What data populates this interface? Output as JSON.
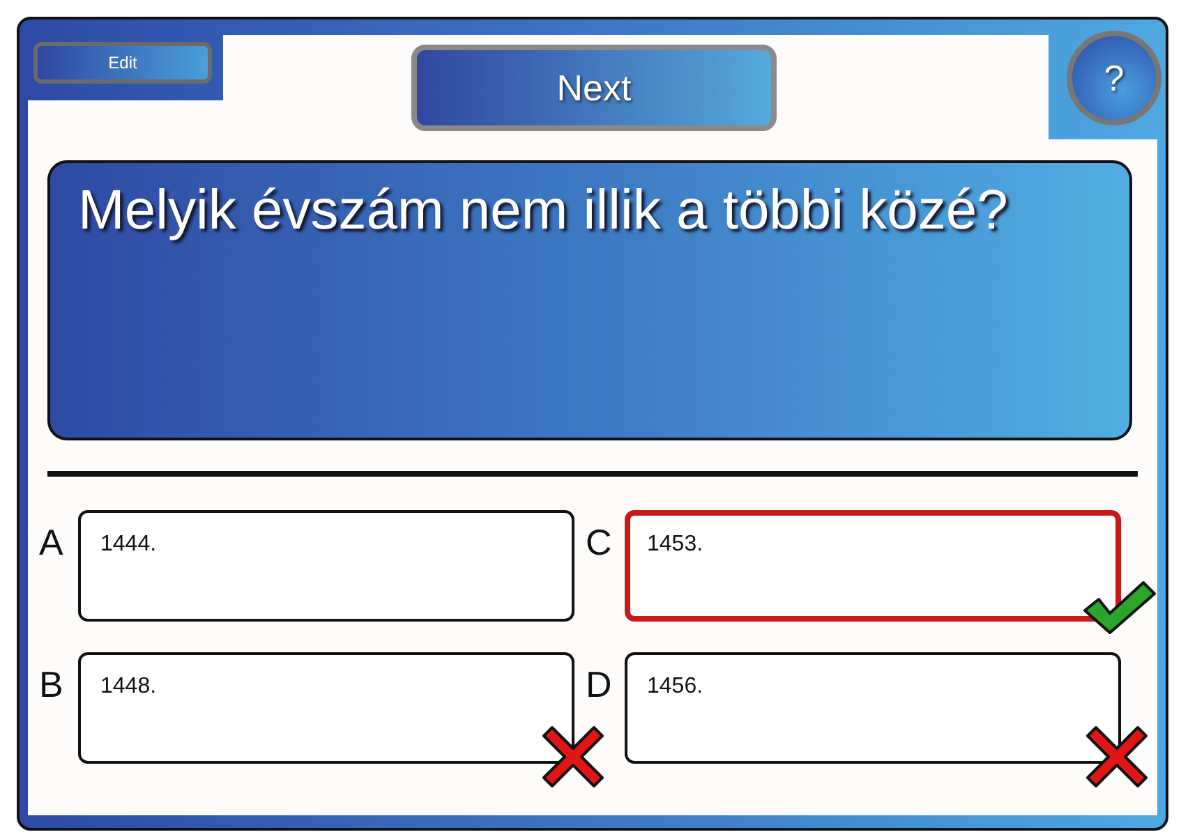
{
  "toolbar": {
    "edit_button": "Edit",
    "next_button": "Next",
    "help_button": "?"
  },
  "question": "Melyik évszám nem illik a többi közé?",
  "answers": [
    {
      "letter": "A",
      "text": "1444.",
      "selected": false,
      "kind": "none"
    },
    {
      "letter": "B",
      "text": "1448.",
      "selected": false,
      "kind": "wrong"
    },
    {
      "letter": "C",
      "text": "1453.",
      "selected": true,
      "kind": "correct"
    },
    {
      "letter": "D",
      "text": "1456.",
      "selected": false,
      "kind": "wrong"
    }
  ]
}
